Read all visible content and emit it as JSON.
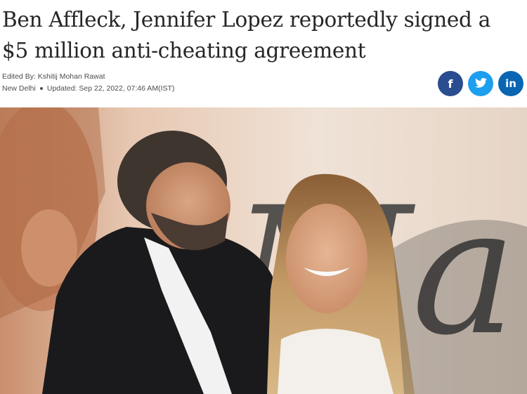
{
  "article": {
    "headline": "Ben Affleck, Jennifer Lopez reportedly signed a $5 million anti-cheating agreement",
    "edited_by": "Edited By: Kshitij Mohan Rawat",
    "location": "New Delhi",
    "updated": "Updated: Sep 22, 2022, 07:46 AM(IST)"
  },
  "share": [
    {
      "icon": "facebook-icon",
      "glyph": "f",
      "color": "#2a4d8f"
    },
    {
      "icon": "twitter-icon",
      "glyph": "t",
      "color": "#1d9ff0"
    },
    {
      "icon": "linkedin-icon",
      "glyph": "in",
      "color": "#0a66b2"
    }
  ],
  "photo": {
    "subject": "Ben Affleck and Jennifer Lopez at a premiere backdrop",
    "backdrop_letters": "Ma"
  }
}
